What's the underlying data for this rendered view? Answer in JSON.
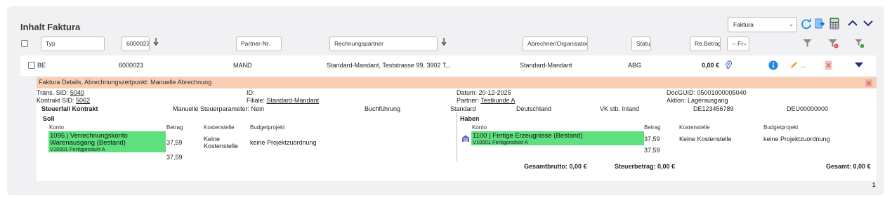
{
  "title": "Inhalt Faktura",
  "toolbar": {
    "view_select": "Faktura"
  },
  "filters": {
    "typ": "Typ",
    "nr": "6000023",
    "partner_nr": "Partner-Nr.",
    "rechnungspartner": "Rechnungspartner",
    "abrechner": "Abrechner/Organisator",
    "status": "Statu",
    "betrag": "Re.Betrag",
    "fr_select": "-- Fr"
  },
  "row": {
    "typ": "BE",
    "nr": "6000023",
    "partner": "MAND",
    "rechnungspartner": "Standard-Mandant, Teststrasse 99, 3902 T...",
    "abrechner": "Standard-Mandant",
    "status": "ABG",
    "betrag": "0,00 €",
    "more": "..."
  },
  "detail": {
    "header": "Faktura Details, Abrechnungszeitpunkt: Manuelle Abrechnung",
    "trans_sid_label": "Trans. SID:",
    "trans_sid": "5040",
    "kontrakt_sid_label": "Kontrakt SID:",
    "kontrakt_sid": "5062",
    "id_label": "ID:",
    "filiale_label": "Filiale:",
    "filiale": "Standard-Mandant",
    "datum_label": "Datum:",
    "datum": "20-12-2025",
    "partner_label": "Partner:",
    "partner": "Testkunde A",
    "docguid_label": "DocGUID:",
    "docguid": "05001000005040",
    "aktion_label": "Aktion:",
    "aktion": "Lagerausgang",
    "steuerfall": {
      "label": "Steuerfall Kontrakt",
      "manuelle": "Manuelle Steuerparameter: Nein",
      "buchfuehrung": "Buchführung",
      "standard": "Standard",
      "land": "Deutschland",
      "vk": "VK stb. Inland",
      "ust1": "DE123456789",
      "ust2": "DEU00000000"
    },
    "soll": {
      "label": "Soll",
      "col_konto": "Konto",
      "col_betrag": "Betrag",
      "col_kostenstelle": "Kostenstelle",
      "col_budget": "Budgetprojekt",
      "konto_line1": "1095 | Verrechnungskonto",
      "konto_line2": "Warenausgang (Bestand)",
      "konto_sub": "V10001 Fertigprodukt A",
      "betrag1": "37,59",
      "betrag2": "37,59",
      "kostenstelle_l1": "Keine",
      "kostenstelle_l2": "Kostenstelle",
      "budget": "keine Projektzuordnung"
    },
    "haben": {
      "label": "Haben",
      "col_konto": "Konto",
      "col_betrag": "Betrag",
      "col_kostenstelle": "Kostenstelle",
      "col_budget": "Budgetprojekt",
      "konto_line1": "1100 | Fertige Erzeugnisse (Bestand)",
      "konto_sub": "V10001 Fertigprodukt A",
      "betrag1": "37,59",
      "betrag2": "37,59",
      "kostenstelle": "Keine Kostenstelle",
      "budget": "keine Projektzuordnung"
    },
    "totals": {
      "brutto": "Gesamtbrutto: 0,00 €",
      "steuer": "Steuerbetrag: 0,00 €",
      "gesamt": "Gesamt: 0,00 €"
    }
  },
  "pagination": {
    "page": "1"
  },
  "colors": {
    "accent_blue": "#1e88e5",
    "detail_header": "#f8cfb3",
    "account_green": "#5ee07f",
    "navy": "#1f2f8a"
  }
}
